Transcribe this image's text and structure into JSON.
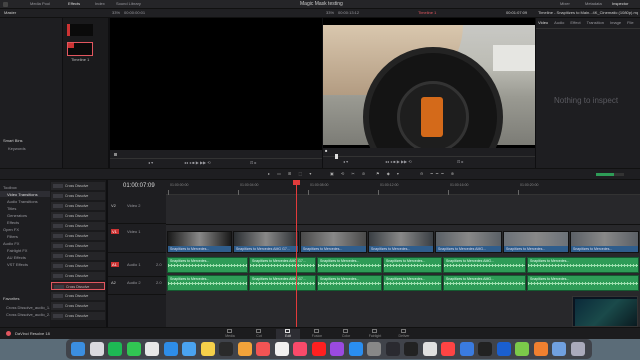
{
  "window": {
    "title": "Magic Mask testing"
  },
  "top_tabs": [
    {
      "label": "Media Pool"
    },
    {
      "label": "Effects"
    },
    {
      "label": "Index"
    },
    {
      "label": "Sound Library"
    }
  ],
  "top_right_tabs": [
    {
      "label": "Mixer"
    },
    {
      "label": "Metadata"
    },
    {
      "label": "Inspector"
    }
  ],
  "viewer_bar": {
    "zoom_left": "33%",
    "tc_left": "00:00:00:01",
    "zoom_right": "33%",
    "tc_right": "00:00:13:12",
    "timeline_name": "Timeline 1",
    "tc_end": "00:01:07:09",
    "inspector_clip": "Timeline - Snapitizes to Main...4K_Cinematic (1080p).mp4"
  },
  "inspector_tabs": [
    "Video",
    "Audio",
    "Effect",
    "Transition",
    "Image",
    "File"
  ],
  "inspector_empty": "Nothing to inspect",
  "left_panel": {
    "master_label": "Master",
    "smart_bins_label": "Smart Bins",
    "keywords_label": "Keywords",
    "clip_label": "Timeline 1"
  },
  "effects_tree": [
    {
      "label": "Toolbox",
      "indent": 0
    },
    {
      "label": "Video Transitions",
      "indent": 1
    },
    {
      "label": "Audio Transitions",
      "indent": 1
    },
    {
      "label": "Titles",
      "indent": 1
    },
    {
      "label": "Generators",
      "indent": 1
    },
    {
      "label": "Effects",
      "indent": 1
    },
    {
      "label": "Open FX",
      "indent": 0
    },
    {
      "label": "Filters",
      "indent": 1
    },
    {
      "label": "Audio FX",
      "indent": 0
    },
    {
      "label": "Fairlight FX",
      "indent": 1
    },
    {
      "label": "AU Effects",
      "indent": 1
    },
    {
      "label": "VST Effects",
      "indent": 1
    }
  ],
  "effects_list": [
    "Cross Dissolve",
    "Cross Dissolve",
    "Cross Dissolve",
    "Cross Dissolve",
    "Cross Dissolve",
    "Cross Dissolve",
    "Cross Dissolve",
    "Cross Dissolve",
    "Cross Dissolve",
    "Cross Dissolve",
    "Cross Dissolve",
    "Cross Dissolve",
    "Cross Dissolve",
    "Cross Dissolve"
  ],
  "favorites": {
    "label": "Favorites",
    "items": [
      "Cross Dissolve_audio_1.07",
      "Cross Dissolve_audio_2.07"
    ]
  },
  "timeline": {
    "timecode": "01:00:07:09",
    "ruler": [
      "01:00:00:00",
      "01:00:04:00",
      "01:00:08:00",
      "01:00:12:00",
      "01:00:16:00",
      "01:00:20:00"
    ],
    "tracks": [
      {
        "id": "V2",
        "name": "Video 2"
      },
      {
        "id": "V1",
        "name": "Video 1"
      },
      {
        "id": "A1",
        "name": "Audio 1",
        "gain": "2.0"
      },
      {
        "id": "A2",
        "name": "Audio 2",
        "gain": "2.0"
      }
    ],
    "video_clip_labels": [
      "Snapitizes to Mercedes...",
      "Snapitizes to Mercedes AMG G7...",
      "Snapitizes to Mercedes...",
      "Snapitizes to Mercedes...",
      "Snapitizes to Mercedes AMG...",
      "Snapitizes to Mercedes...",
      "Snapitizes to Mercedes..."
    ],
    "audio_clip_labels": [
      "Snapitizes to Mercedes...",
      "Snapitizes to Mercedes AMG G7...",
      "Snapitizes to Mercedes...",
      "Snapitizes to Mercedes...",
      "Snapitizes to Mercedes AMG...",
      "Snapitizes to Mercedes..."
    ]
  },
  "page_tabs": [
    {
      "label": "Media"
    },
    {
      "label": "Cut"
    },
    {
      "label": "Edit"
    },
    {
      "label": "Fusion"
    },
    {
      "label": "Color"
    },
    {
      "label": "Fairlight"
    },
    {
      "label": "Deliver"
    }
  ],
  "app_name": "DaVinci Resolve 18",
  "dock_icons": [
    "finder-icon",
    "launchpad-icon",
    "spotify-icon",
    "messages-icon",
    "chrome-icon",
    "safari-icon",
    "mail-icon",
    "notes-icon",
    "activity-icon",
    "photos-icon",
    "calendar-icon",
    "reminders-icon",
    "music-icon",
    "youtube-icon",
    "podcasts-icon",
    "appstore-icon",
    "settings-icon",
    "resolve-icon",
    "capcut-icon",
    "scissors-icon",
    "yandex-icon",
    "vpn-icon",
    "terminal-icon",
    "bitwarden-icon",
    "android-icon",
    "fire-icon",
    "preview-icon",
    "trash-icon"
  ],
  "colors": {
    "accent": "#e2565f",
    "playhead": "#e23b3b",
    "video_clip": "#2f5d8c",
    "audio_clip": "#2e9c57",
    "audio_wave": "#9fe0b0"
  }
}
